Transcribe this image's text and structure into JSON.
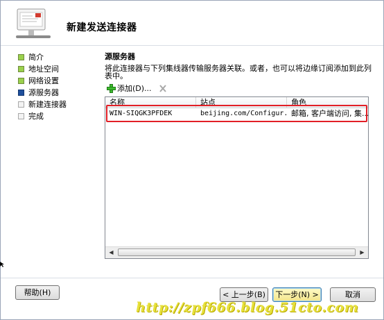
{
  "header": {
    "title": "新建发送连接器"
  },
  "nav": {
    "items": [
      {
        "label": "简介",
        "state": "done"
      },
      {
        "label": "地址空间",
        "state": "done"
      },
      {
        "label": "网络设置",
        "state": "done"
      },
      {
        "label": "源服务器",
        "state": "current"
      },
      {
        "label": "新建连接器",
        "state": "pending"
      },
      {
        "label": "完成",
        "state": "pending"
      }
    ]
  },
  "main": {
    "section_title": "源服务器",
    "description": "将此连接器与下列集线器传输服务器关联。或者，也可以将边缘订阅添加到此列表中。",
    "toolbar": {
      "add_label": "添加(D)...",
      "add_icon": "plus-icon",
      "delete_icon": "delete-x-icon"
    },
    "table": {
      "columns": [
        "名称",
        "站点",
        "角色"
      ],
      "rows": [
        [
          "WIN-SIQGK3PFDEK",
          "beijing.com/Configur...",
          "邮箱, 客户端访问, 集..."
        ]
      ]
    }
  },
  "footer": {
    "help_label": "帮助(H)",
    "back_label": "< 上一步(B)",
    "next_label": "下一步(N) >",
    "cancel_label": "取消"
  },
  "watermark": "http://zpf666.blog.51cto.com",
  "colors": {
    "done": "#9ad14c",
    "current": "#1f4f9c",
    "highlight": "#e21f26",
    "watermark": "#e7e13b"
  }
}
